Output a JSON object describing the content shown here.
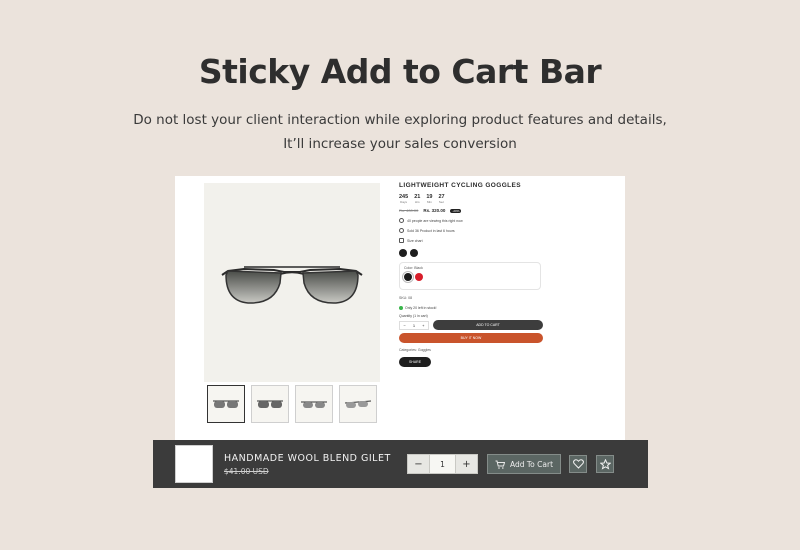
{
  "hero": {
    "title": "Sticky Add to Cart Bar",
    "subtitle_line1": "Do not lost your client interaction while exploring product features and details,",
    "subtitle_line2": "It’ll increase your sales conversion"
  },
  "product": {
    "title": "LIGHTWEIGHT CYCLING GOGGLES",
    "countdown": [
      {
        "value": "245",
        "label": "Days"
      },
      {
        "value": "21",
        "label": "Hrs"
      },
      {
        "value": "19",
        "label": "Min"
      },
      {
        "value": "27",
        "label": "Sec"
      }
    ],
    "old_price": "Rs. 400.00",
    "new_price": "Rs. 320.00",
    "discount_badge": "-20%",
    "viewers_text": "40 people are viewing this right now",
    "sold_text": "Sold 36 Product in last 6 hours",
    "size_chart": "Size chart",
    "color_label": "Color: Black",
    "sku": "SKU: 08",
    "stock_text": "Only 20 left in stock!",
    "quantity_label": "Quantity (1 in cart)",
    "quantity_value": "1",
    "add_to_cart_label": "ADD TO CART",
    "buy_now_label": "BUY IT NOW",
    "categories": "Categories: Goggles",
    "share_label": "SHARE",
    "colors": {
      "black": "#1b1b1b",
      "red": "#d81e2a",
      "accent": "#c9542c"
    }
  },
  "sticky_bar": {
    "title": "HANDMADE WOOL BLEND GILET",
    "price": "$41.00 USD",
    "qty_minus": "−",
    "qty_value": "1",
    "qty_plus": "+",
    "add_to_cart": "Add To Cart",
    "icons": [
      "cart-icon",
      "heart-icon",
      "star-icon"
    ]
  }
}
